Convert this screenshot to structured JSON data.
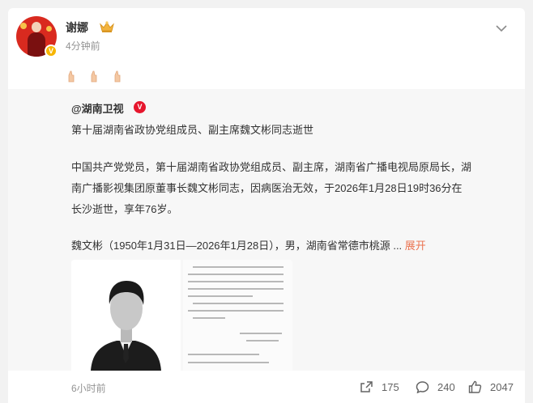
{
  "post": {
    "author": "谢娜",
    "time": "4分钟前",
    "verified_mark": "V"
  },
  "repost": {
    "author": "@湖南卫视",
    "verified_mark": "V",
    "headline": "第十届湖南省政协党组成员、副主席魏文彬同志逝世",
    "body_line1": "中国共产党党员，第十届湖南省政协党组成员、副主席，湖南省广播电视局原局长，湖",
    "body_line2": "南广播影视集团原董事长魏文彬同志，因病医治无效，于2026年1月28日19时36分在",
    "body_line3": "长沙逝世，享年76岁。",
    "body_line4": "魏文彬（1950年1月31日—2026年1月28日），男，湖南省常德市桃源 ...",
    "expand": "展开",
    "time": "6小时前",
    "stats": {
      "reposts": "175",
      "comments": "240",
      "likes": "2047"
    }
  },
  "colors": {
    "accent_link": "#eb7350",
    "verified_red": "#e6162d",
    "verified_gold": "#f7b500",
    "muted_text": "#939393"
  }
}
